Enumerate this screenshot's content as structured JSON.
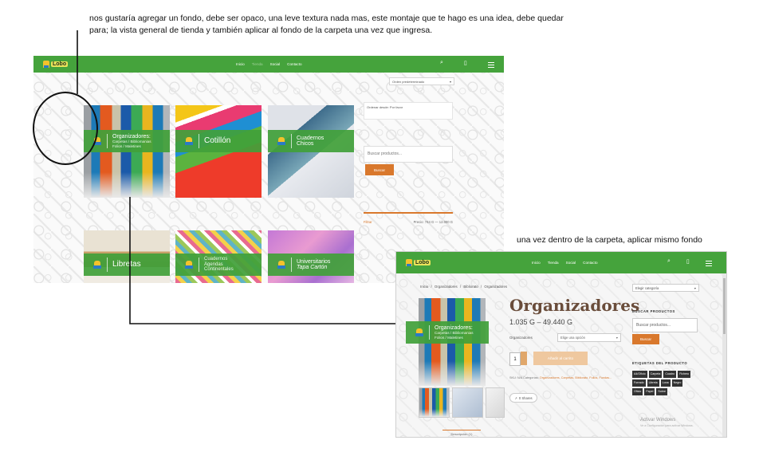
{
  "notes": {
    "top": "nos gustaría agregar un fondo, debe ser opaco, una leve textura nada mas, este montaje que te hago es una idea, debe quedar para; la vista general de tienda y también aplicar al fondo de la carpeta una vez que ingresa.",
    "second": "una vez dentro de la carpeta, aplicar mismo fondo"
  },
  "colors": {
    "nav_green": "#45a33c",
    "accent_orange": "#d9782c",
    "band_green": "#42a03a",
    "title_brown": "#6a4d3b"
  },
  "shop": {
    "logo": "Lobo",
    "nav": [
      "Inicio",
      "Tienda",
      "Social",
      "Contacto"
    ],
    "active_nav": "Tienda",
    "sort_select": "Orden predeterminado",
    "panel_text": "Ordenar desde: Por favor",
    "search_placeholder": "Buscar productos...",
    "search_button": "Buscar",
    "price_filter": {
      "button": "Filtrar",
      "range": "Precio: 744 G — 12.000 G"
    },
    "categories": [
      {
        "title": "Organizadores:",
        "sub1": "Carpetas / Bibliomanias",
        "sub2": "Folios / Maletines"
      },
      {
        "title": "Cotillón"
      },
      {
        "title": "Cuadernos",
        "title2": "Chicos"
      },
      {
        "title": "Libretas"
      },
      {
        "title": "Cuadernos",
        "title2": "Agendas",
        "title3": "Continentales"
      },
      {
        "title": "Universitarios",
        "title2": "Tapa Cartón"
      }
    ],
    "icons": [
      "search-icon",
      "cart-icon",
      "menu-icon"
    ]
  },
  "product": {
    "breadcrumb": "Inicio  /  Organizadores  /  Bibliorato  /  Organizadores",
    "title": "Organizadores",
    "price": "1.035 G – 49.440 G",
    "option_label": "Organizadores",
    "option_value": "Elige una opción",
    "quantity": "1",
    "add_to_cart": "Añadir al carrito",
    "meta_label": "SKU: N/A  Categorías:",
    "meta_links": "Organizadores, Carpetas, Bibliorato, Folios, Fundas...",
    "share": "0 Shares",
    "tab_label": "Descripción (1)",
    "sidebar": {
      "select": "Elegir categoría",
      "search_heading": "BUSCAR PRODUCTOS",
      "search_placeholder": "Buscar productos...",
      "search_button": "Buscar",
      "tags_heading": "ETIQUETAS DEL PRODUCTO",
      "tags": [
        "A4/Oficio",
        "Carpeta",
        "Cuadro",
        "Fichero",
        "Forrado",
        "Libreta",
        "Lona",
        "Negro",
        "Oficio",
        "Papel",
        "Sobre"
      ],
      "activate": "Activar Windows",
      "activate_sub": "Ve a Configuración para activar Windows."
    }
  }
}
